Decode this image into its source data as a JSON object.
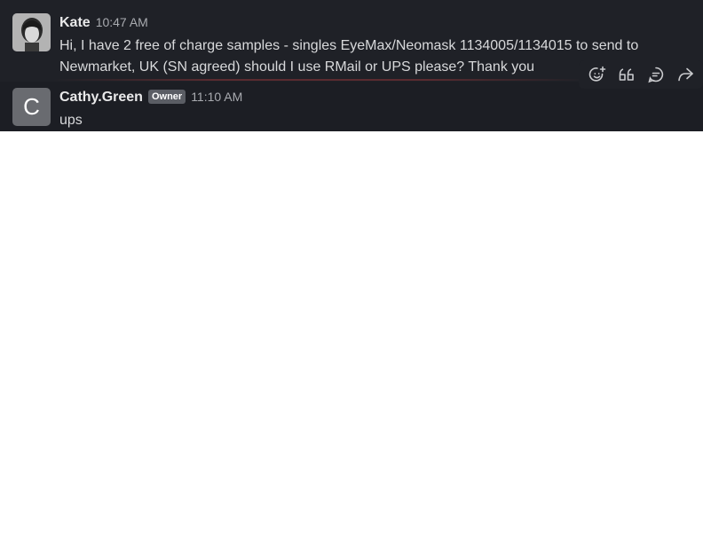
{
  "messages": [
    {
      "author": "Kate",
      "time": "10:47 AM",
      "text": "Hi, I have 2 free of charge samples - singles EyeMax/Neomask 1134005/1134015 to send to Newmarket, UK (SN agreed) should I use RMail or UPS please? Thank you",
      "avatar": "photo-avatar"
    },
    {
      "author": "Cathy.Green",
      "badge": "Owner",
      "time": "11:10 AM",
      "text": "ups",
      "avatar_letter": "C"
    }
  ],
  "actions": [
    {
      "icon": "add-reaction-icon"
    },
    {
      "icon": "quote-icon"
    },
    {
      "icon": "reply-in-thread-icon"
    },
    {
      "icon": "forward-icon"
    }
  ],
  "colors": {
    "background": "#1f2127",
    "author": "#e9e9ea",
    "text": "#d8d9db",
    "time": "#a9abb0",
    "badge_bg": "#5a5d64",
    "avatar_c_bg": "#696b70"
  }
}
